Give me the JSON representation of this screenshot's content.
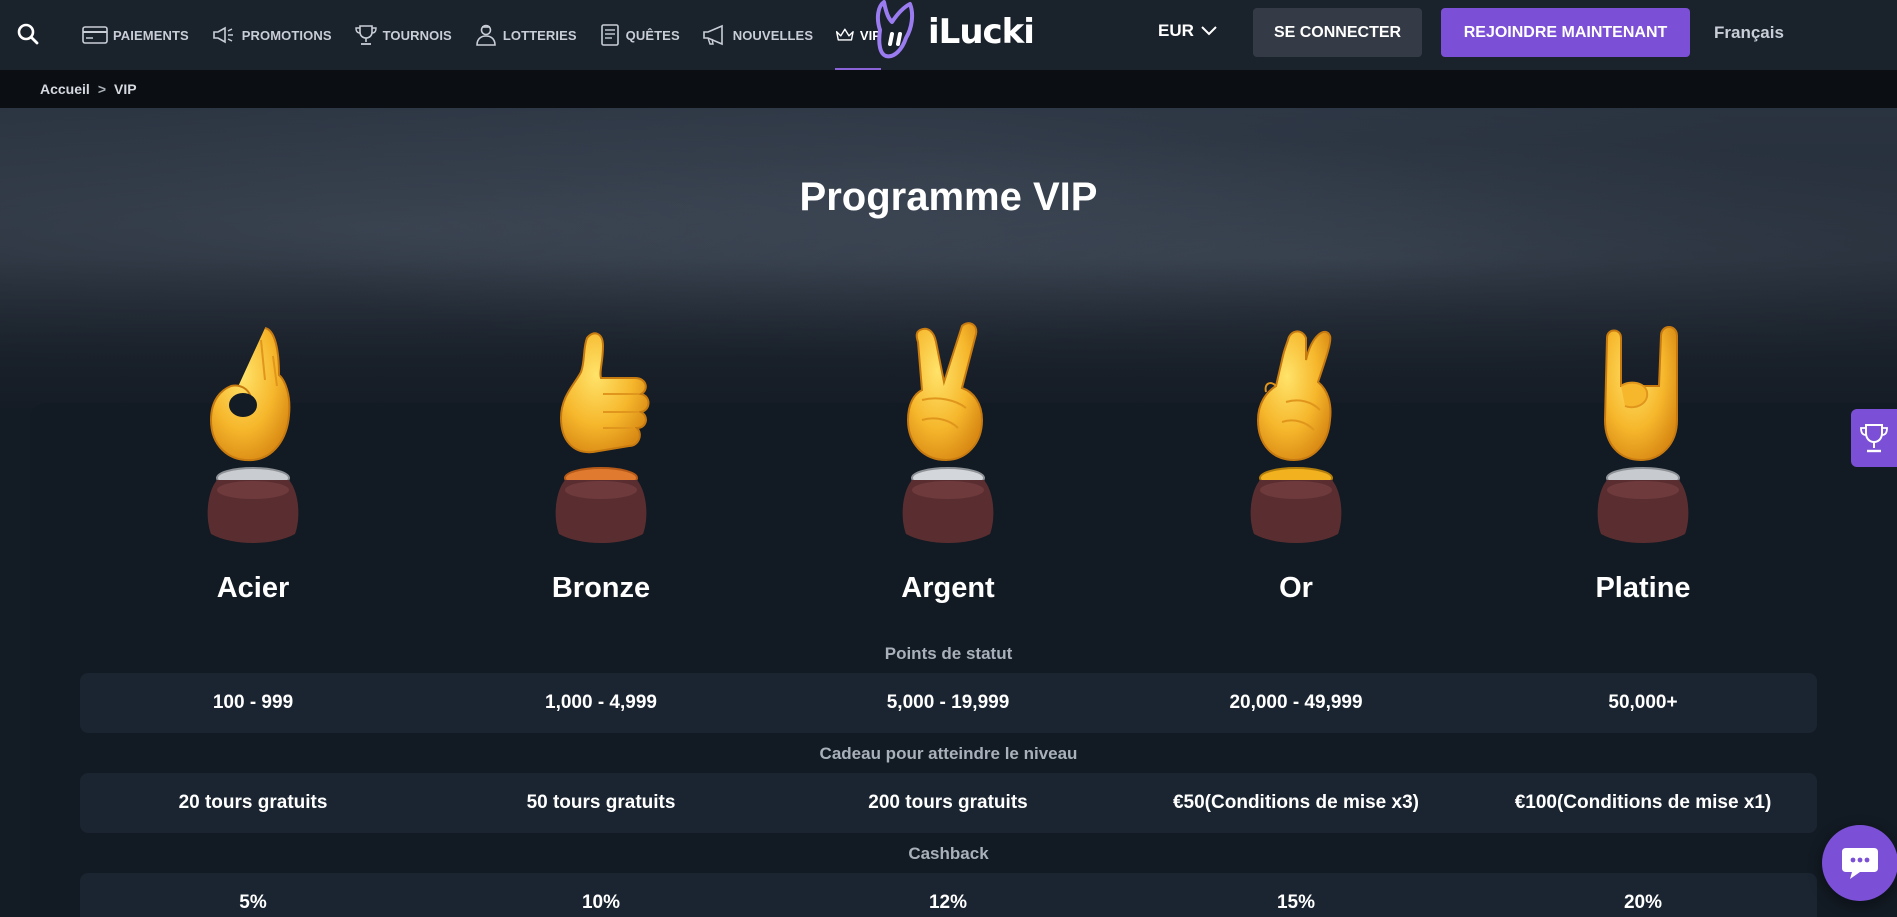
{
  "header": {
    "nav": [
      {
        "label": "PAIEMENTS",
        "icon": "card-icon"
      },
      {
        "label": "PROMOTIONS",
        "icon": "megaphone-icon"
      },
      {
        "label": "TOURNOIS",
        "icon": "trophy-icon"
      },
      {
        "label": "LOTTERIES",
        "icon": "person-icon"
      },
      {
        "label": "QUÊTES",
        "icon": "document-icon"
      },
      {
        "label": "NOUVELLES",
        "icon": "bullhorn-icon"
      },
      {
        "label": "VIP",
        "icon": "crown-icon"
      }
    ],
    "logo_text": "iLucki",
    "currency": "EUR",
    "login_label": "SE CONNECTER",
    "join_label": "REJOINDRE MAINTENANT",
    "language": "Français"
  },
  "breadcrumb": {
    "home": "Accueil",
    "separator": ">",
    "current": "VIP"
  },
  "hero": {
    "title": "Programme VIP"
  },
  "tiers": [
    {
      "name": "Acier",
      "gesture": "ok-hand",
      "base_color": "#c9ccd0"
    },
    {
      "name": "Bronze",
      "gesture": "thumbs-up",
      "base_color": "#e07a2e"
    },
    {
      "name": "Argent",
      "gesture": "victory-hand",
      "base_color": "#d3d6da"
    },
    {
      "name": "Or",
      "gesture": "crossed-fingers",
      "base_color": "#f2b21f"
    },
    {
      "name": "Platine",
      "gesture": "rock-on-hand",
      "base_color": "#c7cbd0"
    }
  ],
  "sections": {
    "status_points": {
      "label": "Points de statut",
      "values": [
        "100 - 999",
        "1,000 - 4,999",
        "5,000 - 19,999",
        "20,000 - 49,999",
        "50,000+"
      ]
    },
    "level_gift": {
      "label": "Cadeau pour atteindre le niveau",
      "values": [
        "20 tours gratuits",
        "50 tours gratuits",
        "200 tours gratuits",
        "€50(Conditions de mise x3)",
        "€100(Conditions de mise x1)"
      ]
    },
    "cashback": {
      "label": "Cashback",
      "values": [
        "5%",
        "10%",
        "12%",
        "15%",
        "20%"
      ]
    }
  },
  "colors": {
    "accent": "#7b4fd6",
    "header_bg": "#1a222c",
    "row_bg": "#1a2531"
  }
}
